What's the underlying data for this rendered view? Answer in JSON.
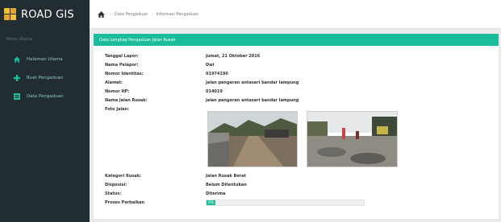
{
  "app": {
    "title": "ROAD GIS"
  },
  "breadcrumb": {
    "items": [
      "Data Pengaduan",
      "Informasi Pengaduan"
    ]
  },
  "sidebar": {
    "header": "Menu Utama",
    "items": [
      {
        "label": "Halaman Utama",
        "icon": "home-icon"
      },
      {
        "label": "Buat Pengaduan",
        "icon": "plus-icon"
      },
      {
        "label": "Data Pengaduan",
        "icon": "list-icon"
      }
    ]
  },
  "panel": {
    "title": "Data Lengkap Pengaduan Jalan Rusak"
  },
  "fields": {
    "tanggal": {
      "label": "Tanggal Lapor:",
      "value": "Jumat, 21 Oktober 2016"
    },
    "nama": {
      "label": "Nama Pelapor:",
      "value": "Dwi"
    },
    "identitas": {
      "label": "Nomor Identitas:",
      "value": "01974190"
    },
    "alamat": {
      "label": "Alamat:",
      "value": "jalan pangeran antasari bandar lampung"
    },
    "hp": {
      "label": "Nomor HP:",
      "value": "014019"
    },
    "jalan": {
      "label": "Nama Jalan Rusak:",
      "value": "jalan pangeran antasari bandar lampung"
    },
    "foto": {
      "label": "Foto Jalan:"
    },
    "kategori": {
      "label": "Kategori Rusak:",
      "value": "Jalan Rusak Berat"
    },
    "disposisi": {
      "label": "Disposisi:",
      "value": "Belum Ditentukan"
    },
    "status": {
      "label": "Status:",
      "value": "Diterima"
    },
    "proses": {
      "label": "Proses Perbaikan",
      "value": "0%",
      "fraction": 0.0
    }
  },
  "colors": {
    "accent": "#1abc9c",
    "sidebar_bg": "#222d32",
    "logo_yellow": "#f2c037"
  }
}
